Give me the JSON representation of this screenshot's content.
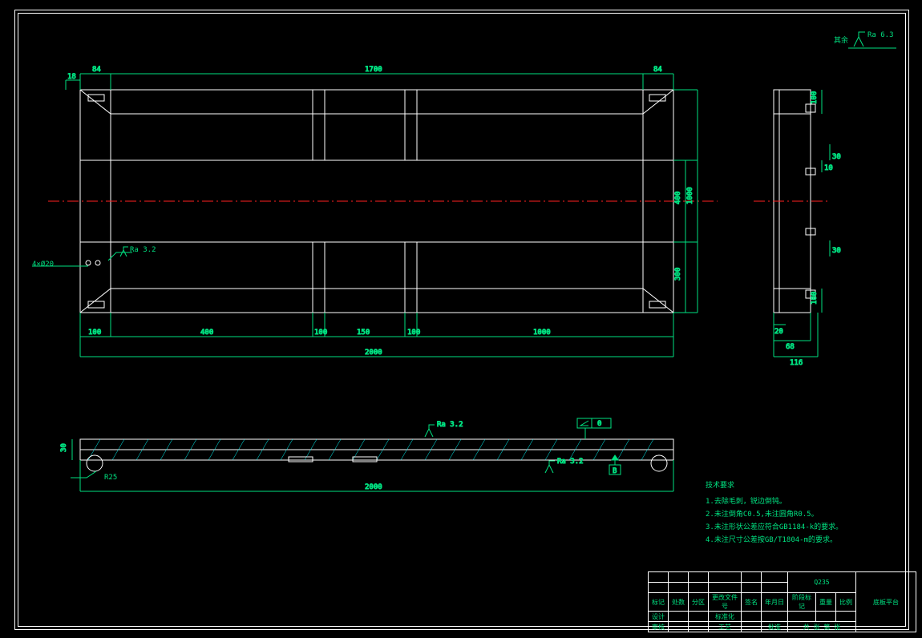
{
  "surface_note": {
    "label": "其余",
    "ra": "Ra 6.3"
  },
  "top_view": {
    "dims_top": {
      "left": "84",
      "center": "1700",
      "right": "84",
      "far_left": "18"
    },
    "dims_bottom": {
      "d1": "100",
      "d2": "400",
      "d3": "100",
      "d4": "150",
      "d5": "100",
      "d6": "1000",
      "overall": "2000"
    },
    "dims_right": {
      "h1": "400",
      "h2": "1000",
      "h3": "300"
    },
    "hole_note": "4×Ø20",
    "hole_ra": "Ra 3.2"
  },
  "side_view": {
    "dims": {
      "h1": "100",
      "h2": "30",
      "h3": "10",
      "h4": "30",
      "h5": "100",
      "h6": "20",
      "h7": "68",
      "w": "116"
    }
  },
  "front_view": {
    "ra_top": "Ra 3.2",
    "ra_bottom": "Ra 3.2",
    "flatness": "0",
    "datum": "B",
    "overall": "2000",
    "height": "30",
    "radius": "R25"
  },
  "tech_req": {
    "title": "技术要求",
    "lines": [
      "1.去除毛刺，锐边倒钝。",
      "2.未注倒角C0.5,未注圆角R0.5。",
      "3.未注形状公差应符合GB1184-k的要求。",
      "4.未注尺寸公差按GB/T1804-m的要求。"
    ]
  },
  "titleblock": {
    "material": "Q235",
    "part_name": "底板平台",
    "row1": [
      "标记",
      "处数",
      "分区",
      "更改文件号",
      "签名",
      "年月日"
    ],
    "row2a": "设计",
    "row2b": "标准化",
    "stage": "阶段标记",
    "weight": "重量",
    "scale": "比例",
    "row3a": "审核",
    "row3b": "工艺",
    "row3c": "批准",
    "sheet": "共 张  第 张"
  }
}
